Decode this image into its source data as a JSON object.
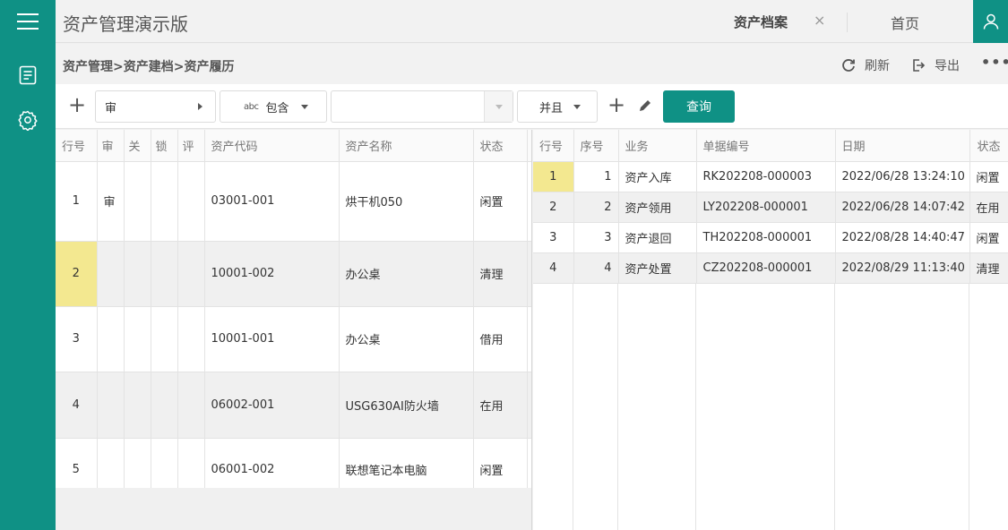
{
  "app": {
    "title": "资产管理演示版"
  },
  "tabs": {
    "active": "资产档案",
    "close": "×",
    "home": "首页"
  },
  "breadcrumb": "资产管理>资产建档>资产履历",
  "actions": {
    "refresh": "刷新",
    "export": "导出",
    "more": "•••"
  },
  "filter": {
    "field": "审",
    "operator": "包含",
    "operator_icon_text": "abc",
    "value": "",
    "logic": "并且",
    "query": "查询"
  },
  "left_table": {
    "columns": [
      "行号",
      "审",
      "关",
      "锁",
      "评",
      "资产代码",
      "资产名称",
      "状态"
    ],
    "rows": [
      {
        "row": "1",
        "audit": "审",
        "close": "",
        "lock": "",
        "rate": "",
        "code": "03001-001",
        "name": "烘干机050",
        "status": "闲置"
      },
      {
        "row": "2",
        "audit": "",
        "close": "",
        "lock": "",
        "rate": "",
        "code": "10001-002",
        "name": "办公桌",
        "status": "清理"
      },
      {
        "row": "3",
        "audit": "",
        "close": "",
        "lock": "",
        "rate": "",
        "code": "10001-001",
        "name": "办公桌",
        "status": "借用"
      },
      {
        "row": "4",
        "audit": "",
        "close": "",
        "lock": "",
        "rate": "",
        "code": "06002-001",
        "name": "USG630AI防火墙",
        "status": "在用"
      },
      {
        "row": "5",
        "audit": "",
        "close": "",
        "lock": "",
        "rate": "",
        "code": "06001-002",
        "name": "联想笔记本电脑",
        "status": "闲置"
      }
    ]
  },
  "right_table": {
    "columns": [
      "行号",
      "序号",
      "业务",
      "单据编号",
      "日期",
      "状态"
    ],
    "rows": [
      {
        "row": "1",
        "seq": "1",
        "biz": "资产入库",
        "doc": "RK202208-000003",
        "date": "2022/06/28 13:24:10",
        "status": "闲置"
      },
      {
        "row": "2",
        "seq": "2",
        "biz": "资产领用",
        "doc": "LY202208-000001",
        "date": "2022/06/28 14:07:42",
        "status": "在用"
      },
      {
        "row": "3",
        "seq": "3",
        "biz": "资产退回",
        "doc": "TH202208-000001",
        "date": "2022/08/28 14:40:47",
        "status": "闲置"
      },
      {
        "row": "4",
        "seq": "4",
        "biz": "资产处置",
        "doc": "CZ202208-000001",
        "date": "2022/08/29 11:13:40",
        "status": "清理"
      }
    ]
  },
  "icons": [
    "menu-icon",
    "document-icon",
    "gear-icon",
    "user-icon",
    "refresh-icon",
    "export-icon",
    "plus-icon",
    "pencil-icon"
  ],
  "colors": {
    "accent": "#0f9185",
    "highlight": "#f3e890"
  }
}
